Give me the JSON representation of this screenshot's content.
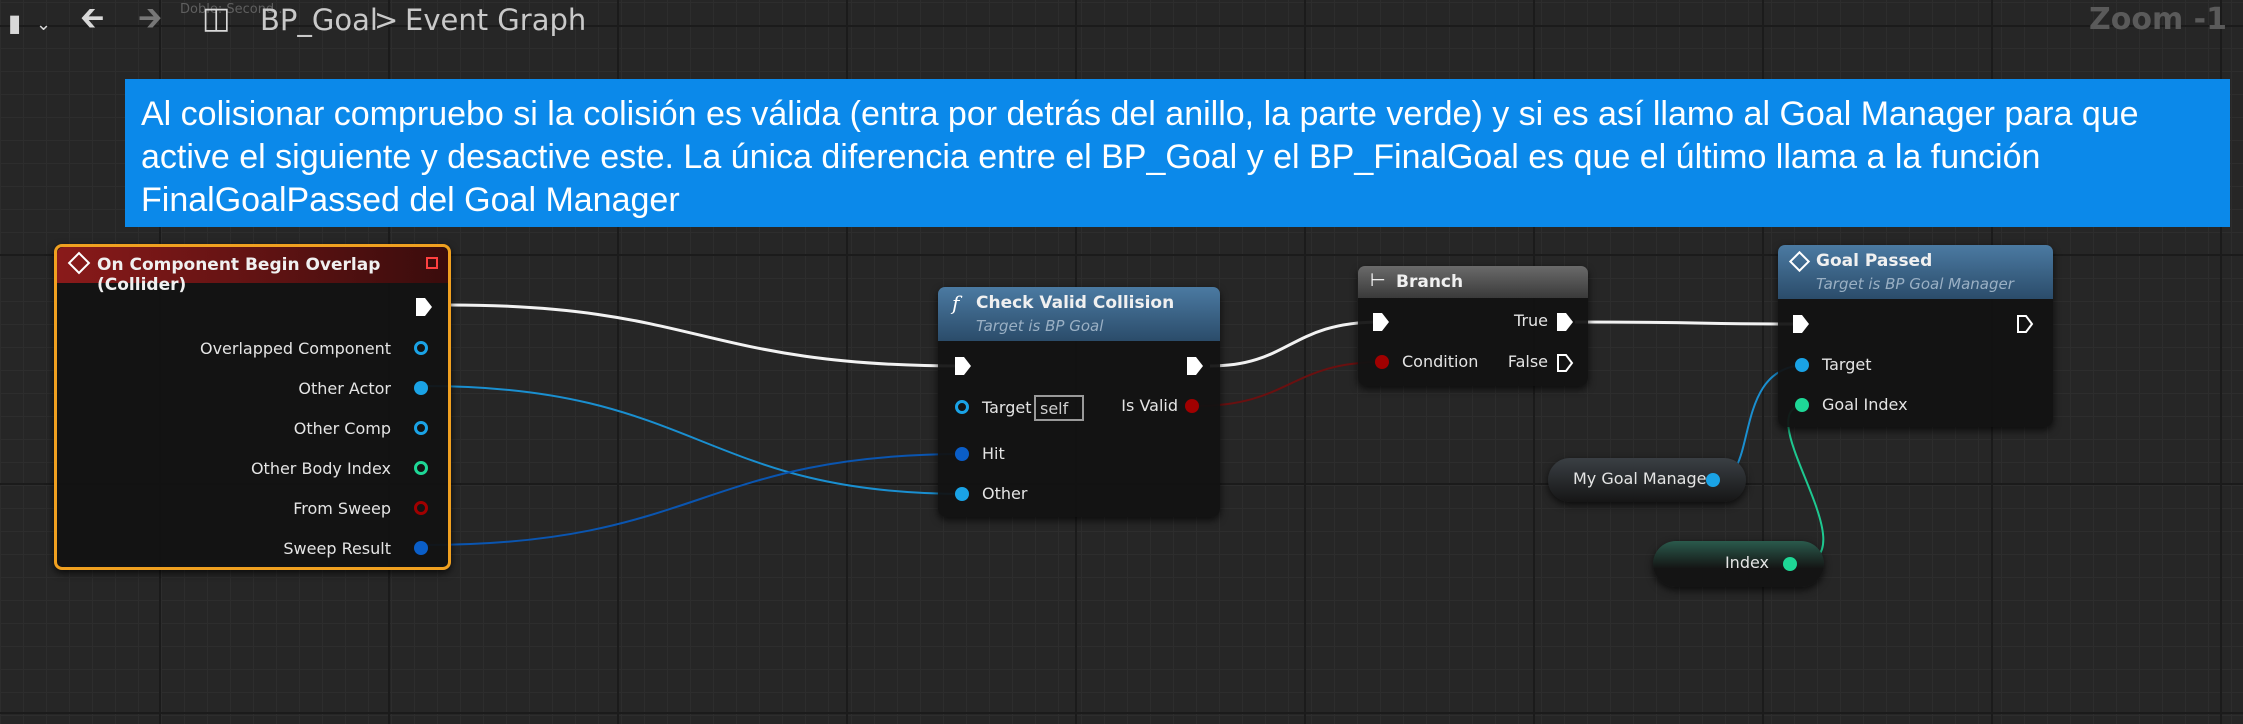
{
  "toolbar": {
    "hint_text": "Doble: Second...",
    "blueprint_name": "BP_Goal",
    "breadcrumb_separator": ">",
    "graph_name": "Event Graph",
    "zoom": "Zoom -1"
  },
  "comment": {
    "text": "Al colisionar compruebo si la colisión es válida (entra por detrás del anillo, la parte verde) y si es así llamo al Goal Manager para que active el siguiente y desactive este. La única diferencia entre el BP_Goal y el BP_FinalGoal es que el último llama a la función FinalGoalPassed del Goal Manager"
  },
  "nodes": {
    "overlap": {
      "title": "On Component Begin Overlap (Collider)",
      "pins": [
        "Overlapped Component",
        "Other Actor",
        "Other Comp",
        "Other Body Index",
        "From Sweep",
        "Sweep Result"
      ]
    },
    "check": {
      "title": "Check Valid Collision",
      "subtitle": "Target is BP Goal",
      "target_label": "Target",
      "target_value": "self",
      "is_valid_label": "Is Valid",
      "hit_label": "Hit",
      "other_label": "Other"
    },
    "branch": {
      "title": "Branch",
      "condition_label": "Condition",
      "true_label": "True",
      "false_label": "False"
    },
    "goal_passed": {
      "title": "Goal Passed",
      "subtitle": "Target is BP Goal Manager",
      "target_label": "Target",
      "goal_index_label": "Goal Index"
    },
    "my_goal_manager": {
      "label": "My Goal Manager"
    },
    "index": {
      "label": "Index"
    }
  },
  "colors": {
    "comment_bg": "#0b89ea",
    "event_header": "#7a1414",
    "function_header": "#3d6486",
    "selection_outline": "#f0a020",
    "object_pin": "#1aa3e6",
    "struct_pin": "#0a5ec8",
    "bool_pin": "#a00000",
    "int_pin": "#1ed796"
  }
}
